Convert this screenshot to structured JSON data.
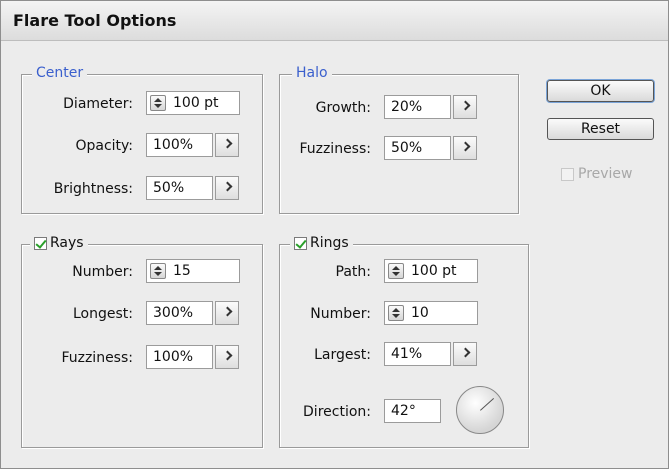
{
  "dialog": {
    "title": "Flare Tool Options"
  },
  "center": {
    "legend": "Center",
    "diameter": {
      "label": "Diameter:",
      "value": "100 pt"
    },
    "opacity": {
      "label": "Opacity:",
      "value": "100%"
    },
    "brightness": {
      "label": "Brightness:",
      "value": "50%"
    }
  },
  "halo": {
    "legend": "Halo",
    "growth": {
      "label": "Growth:",
      "value": "20%"
    },
    "fuzziness": {
      "label": "Fuzziness:",
      "value": "50%"
    }
  },
  "rays": {
    "legend": "Rays",
    "checked": true,
    "number": {
      "label": "Number:",
      "value": "15"
    },
    "longest": {
      "label": "Longest:",
      "value": "300%"
    },
    "fuzziness": {
      "label": "Fuzziness:",
      "value": "100%"
    }
  },
  "rings": {
    "legend": "Rings",
    "checked": true,
    "path": {
      "label": "Path:",
      "value": "100 pt"
    },
    "number": {
      "label": "Number:",
      "value": "10"
    },
    "largest": {
      "label": "Largest:",
      "value": "41%"
    },
    "direction": {
      "label": "Direction:",
      "value": "42°"
    }
  },
  "buttons": {
    "ok": "OK",
    "reset": "Reset"
  },
  "preview": {
    "label": "Preview",
    "checked": false,
    "enabled": false
  },
  "colors": {
    "legend_blue": "#3a5fcd",
    "check_green": "#2aa02a",
    "background": "#ececec"
  },
  "icons": [
    "spinner-icon",
    "right-arrow-icon",
    "direction-dial-icon",
    "checkmark-icon"
  ]
}
